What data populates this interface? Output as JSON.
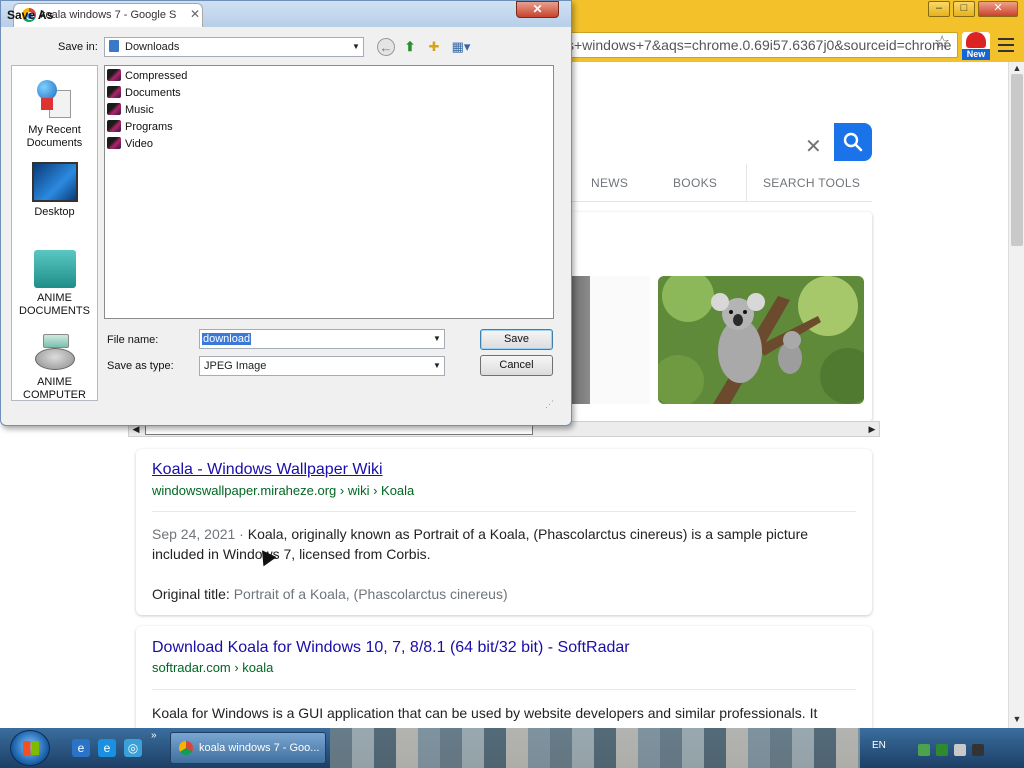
{
  "browser": {
    "omnibox_text": "s+windows+7&aqs=chrome.0.69i57.6367j0&sourceid=chrome",
    "extension_badge": "New",
    "window_controls": {
      "minimize": "–",
      "maximize": "□",
      "close": "✕"
    }
  },
  "search": {
    "clear_icon": "✕",
    "tabs": [
      "NEWS",
      "BOOKS",
      "SEARCH TOOLS"
    ]
  },
  "results": [
    {
      "title": "Koala - Windows Wallpaper Wiki",
      "url": "windowswallpaper.miraheze.org › wiki › Koala",
      "date": "Sep 24, 2021 ·",
      "snippet": "Koala, originally known as Portrait of a Koala, (Phascolarctus cinereus) is a sample picture included in Windows 7, licensed from Corbis.",
      "original_title_label": "Original title:",
      "original_title_value": "Portrait of a Koala, (Phascolarctus cinereus)"
    },
    {
      "title": "Download Koala for Windows 10, 7, 8/8.1 (64 bit/32 bit) - SoftRadar",
      "url": "softradar.com › koala",
      "snippet": "Koala for Windows is a GUI application that can be used by website developers and similar professionals. It"
    }
  ],
  "dialog": {
    "title": "Save As",
    "background_tab": "koala windows 7 - Google S",
    "close_label": "✕",
    "save_in_label": "Save in:",
    "save_in_value": "Downloads",
    "places": [
      {
        "label": "My Recent Documents",
        "icon": "recent-documents-icon"
      },
      {
        "label": "Desktop",
        "icon": "desktop-icon"
      },
      {
        "label": "ANIME DOCUMENTS",
        "icon": "anime-documents-icon"
      },
      {
        "label": "ANIME COMPUTER",
        "icon": "anime-computer-icon"
      }
    ],
    "files": [
      "Compressed",
      "Documents",
      "Music",
      "Programs",
      "Video"
    ],
    "file_name_label": "File name:",
    "file_name_value": "download",
    "save_as_type_label": "Save as type:",
    "save_as_type_value": "JPEG Image",
    "save_button": "Save",
    "cancel_button": "Cancel"
  },
  "taskbar": {
    "task_label": "koala windows 7 - Goo...",
    "language": "EN",
    "more": "»"
  }
}
